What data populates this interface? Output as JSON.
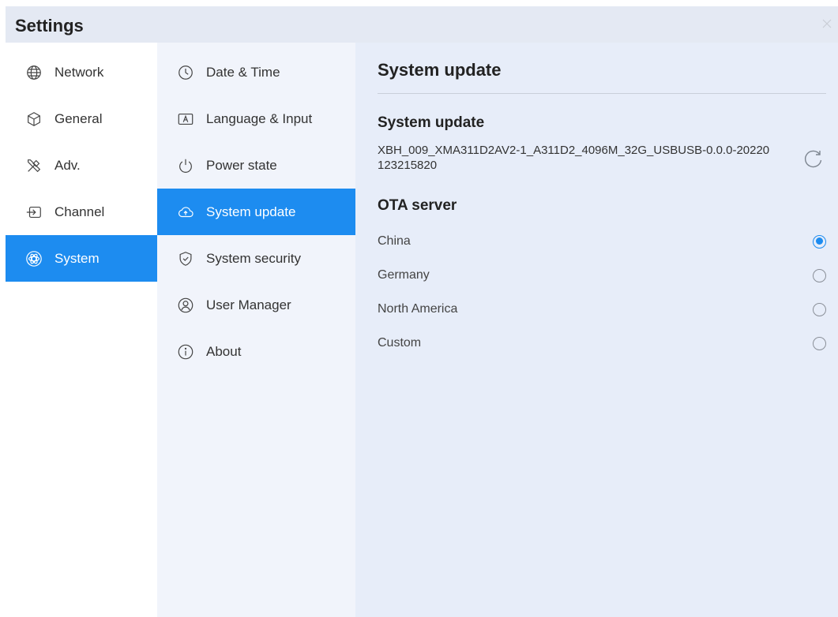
{
  "window": {
    "title": "Settings"
  },
  "sidebar": {
    "items": [
      {
        "label": "Network",
        "icon": "globe-icon"
      },
      {
        "label": "General",
        "icon": "cube-icon"
      },
      {
        "label": "Adv.",
        "icon": "tools-icon"
      },
      {
        "label": "Channel",
        "icon": "input-icon"
      },
      {
        "label": "System",
        "icon": "atom-icon",
        "active": true
      }
    ]
  },
  "submenu": {
    "items": [
      {
        "label": "Date & Time",
        "icon": "clock-icon"
      },
      {
        "label": "Language & Input",
        "icon": "keyboard-letter-icon"
      },
      {
        "label": "Power state",
        "icon": "power-icon"
      },
      {
        "label": "System update",
        "icon": "cloud-upload-icon",
        "active": true
      },
      {
        "label": "System security",
        "icon": "shield-check-icon"
      },
      {
        "label": "User Manager",
        "icon": "user-icon"
      },
      {
        "label": "About",
        "icon": "info-icon"
      }
    ]
  },
  "content": {
    "header": "System update",
    "update_title": "System update",
    "version": "XBH_009_XMA311D2AV2-1_A311D2_4096M_32G_USBUSB-0.0.0-20220123215820",
    "ota_title": "OTA server",
    "ota_options": [
      {
        "label": "China",
        "selected": true
      },
      {
        "label": "Germany",
        "selected": false
      },
      {
        "label": "North America",
        "selected": false
      },
      {
        "label": "Custom",
        "selected": false
      }
    ]
  },
  "colors": {
    "accent": "#1d8cf0",
    "window_bg": "#e9eef8",
    "sidebar_bg": "#ffffff",
    "submenu_bg": "#f1f4fb",
    "content_bg": "#e7edf9"
  }
}
